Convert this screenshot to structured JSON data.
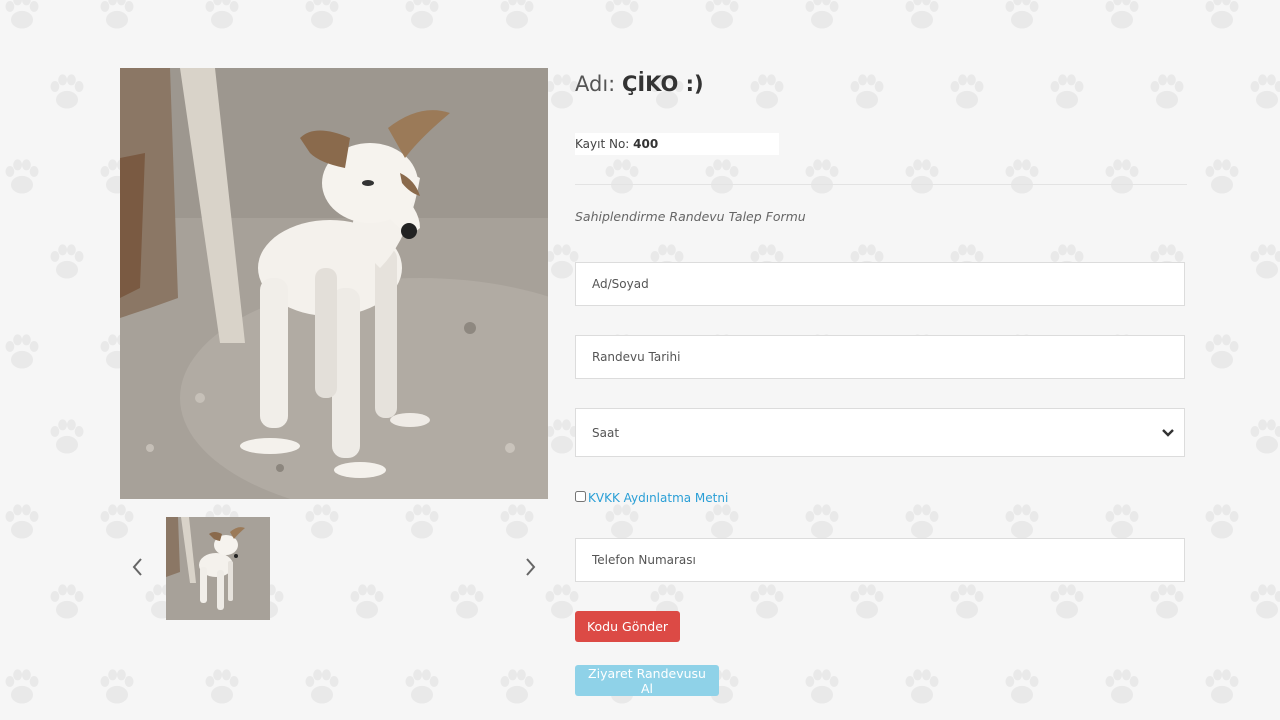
{
  "pet": {
    "name_label": "Adı:",
    "name": "ÇİKO :)",
    "reg_label": "Kayıt No:",
    "reg_no": "400"
  },
  "form": {
    "title": "Sahiplendirme Randevu Talep Formu",
    "name_placeholder": "Ad/Soyad",
    "date_placeholder": "Randevu Tarihi",
    "time_selected": "Saat",
    "kvkk_link": "KVKK Aydınlatma Metni",
    "phone_placeholder": "Telefon Numarası",
    "send_code_button": "Kodu Gönder",
    "appointment_button": "Ziyaret Randevusu Al"
  },
  "gallery": {
    "prev_icon": "chevron-left-icon",
    "next_icon": "chevron-right-icon"
  },
  "colors": {
    "background": "#f6f6f6",
    "paw_pattern": "#e9e9e9",
    "send_code_button": "#dc4a45",
    "appointment_button": "#8fd2e8",
    "link": "#2a9fd6"
  }
}
